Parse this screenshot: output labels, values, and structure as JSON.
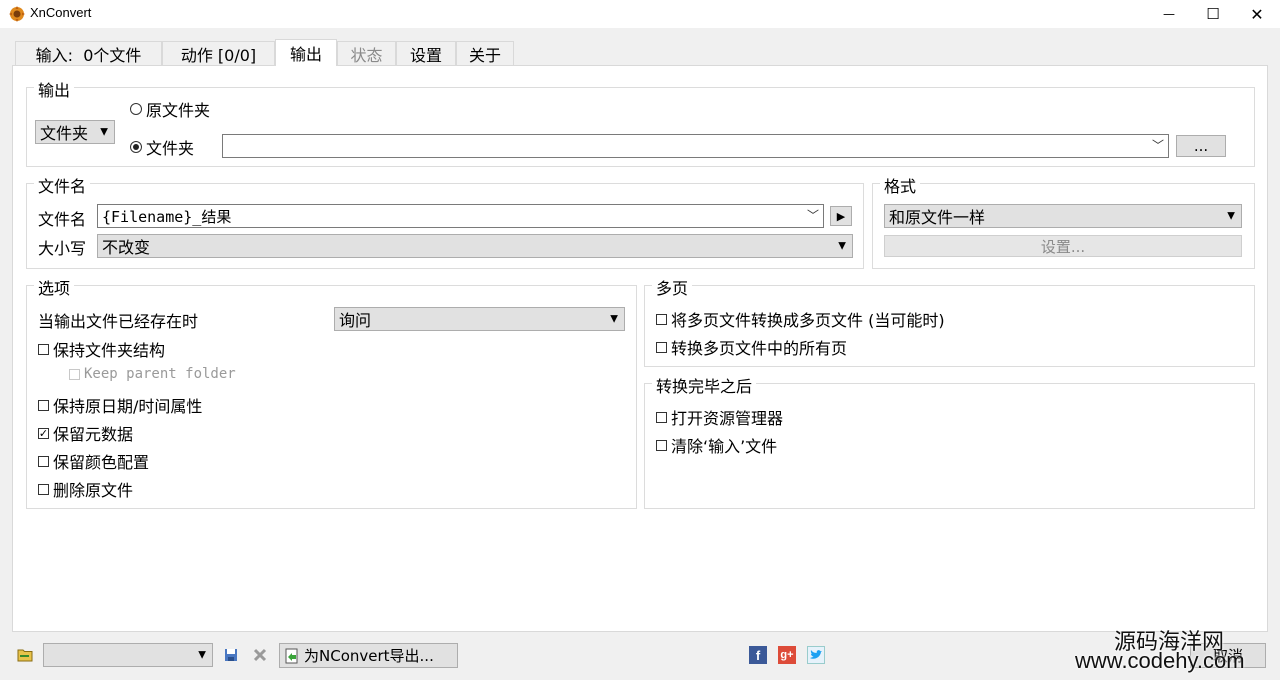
{
  "window": {
    "title": "XnConvert",
    "minimize_glyph": "—",
    "maximize_glyph": "☐",
    "close_glyph": "✕"
  },
  "tabs": [
    {
      "label": "输入:  0个文件"
    },
    {
      "label": "动作 [0/0]"
    },
    {
      "label": "输出"
    },
    {
      "label": "状态"
    },
    {
      "label": "设置"
    },
    {
      "label": "关于"
    }
  ],
  "output": {
    "group_title": "输出",
    "destination_select": "文件夹",
    "radio_original": "原文件夹",
    "radio_folder": "文件夹",
    "folder_path": "",
    "browse_label": "..."
  },
  "filename": {
    "group_title": "文件名",
    "name_label": "文件名",
    "name_value": "{Filename}_结果",
    "case_label": "大小写",
    "case_value": "不改变"
  },
  "format": {
    "group_title": "格式",
    "format_value": "和原文件一样",
    "settings_label": "设置..."
  },
  "options": {
    "group_title": "选项",
    "exists_label": "当输出文件已经存在时",
    "exists_value": "询问",
    "keep_folder_structure": "保持文件夹结构",
    "keep_parent_folder": "Keep parent folder",
    "keep_datetime": "保持原日期/时间属性",
    "keep_metadata": "保留元数据",
    "keep_color_profile": "保留颜色配置",
    "delete_original": "删除原文件",
    "checked_glyph": "✓"
  },
  "multipage": {
    "group_title": "多页",
    "convert_multipage": "将多页文件转换成多页文件 (当可能时)",
    "convert_all_pages": "转换多页文件中的所有页"
  },
  "after": {
    "group_title": "转换完毕之后",
    "open_explorer": "打开资源管理器",
    "clear_input": "清除‘输入’文件"
  },
  "footer": {
    "preset_value": "",
    "export_label": "为NConvert导出...",
    "cancel_label": "取消",
    "watermark_line1": "源码海洋网",
    "watermark_line2": "www.codehy.com"
  },
  "colors": {
    "facebook": "#3b5998",
    "googleplus": "#dd4b39",
    "twitter": "#1da1f2"
  }
}
